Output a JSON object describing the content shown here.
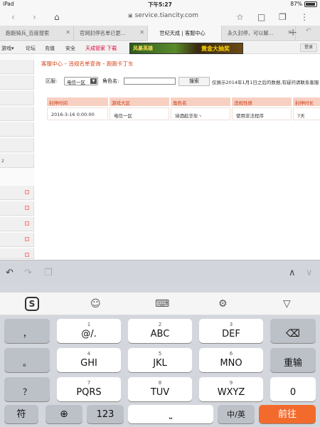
{
  "status": {
    "device": "iPad",
    "time": "下午5:27",
    "battery": "87%"
  },
  "browser": {
    "url": "service.tiancity.com"
  },
  "tabs": [
    {
      "label": "跑跑骑兵_百度搜索"
    },
    {
      "label": "官网封停名单已更..."
    },
    {
      "label": "世纪天成 | 客服中心"
    },
    {
      "label": "永久封停，可以解..."
    }
  ],
  "sitenav": {
    "items": [
      "游戏▾",
      "论坛",
      "充值",
      "安全"
    ],
    "promo": "天成管家  下载",
    "banner_left": "风暴英雄",
    "banner_right": "黄金大抽奖",
    "login": "登录"
  },
  "sidebar": {
    "label_2": "2"
  },
  "content": {
    "breadcrumb": "客服中心 – 违规名单查询 – 跑跑卡丁车",
    "region_label": "区服:",
    "region_value": "电信一区",
    "role_label": "角色名:",
    "role_value": "",
    "search_btn": "搜索",
    "note": "仅展示2014年1月1日之后的数据,有疑问请联系客服",
    "headers": [
      "封停时间",
      "游戏大区",
      "角色名",
      "违规性质",
      "封停时长"
    ],
    "row": [
      "2016-3-16 0:00:00",
      "电信一区",
      "诗酒趁华年丶",
      "使用非法程序",
      "7天"
    ]
  },
  "keyboard": {
    "row1": [
      {
        "sub": "",
        "main": "，"
      },
      {
        "sub": "1",
        "main": "@/."
      },
      {
        "sub": "2",
        "main": "ABC"
      },
      {
        "sub": "3",
        "main": "DEF"
      }
    ],
    "row2": [
      {
        "sub": "",
        "main": "。"
      },
      {
        "sub": "4",
        "main": "GHI"
      },
      {
        "sub": "5",
        "main": "JKL"
      },
      {
        "sub": "6",
        "main": "MNO"
      },
      {
        "sub": "",
        "main": "重输"
      }
    ],
    "row3": [
      {
        "sub": "",
        "main": "？"
      },
      {
        "sub": "7",
        "main": "PQRS"
      },
      {
        "sub": "8",
        "main": "TUV"
      },
      {
        "sub": "9",
        "main": "WXYZ"
      },
      {
        "sub": "",
        "main": "0"
      }
    ],
    "row4": [
      "符",
      "123",
      "中/英",
      "前往"
    ],
    "row0_extra": "！"
  }
}
